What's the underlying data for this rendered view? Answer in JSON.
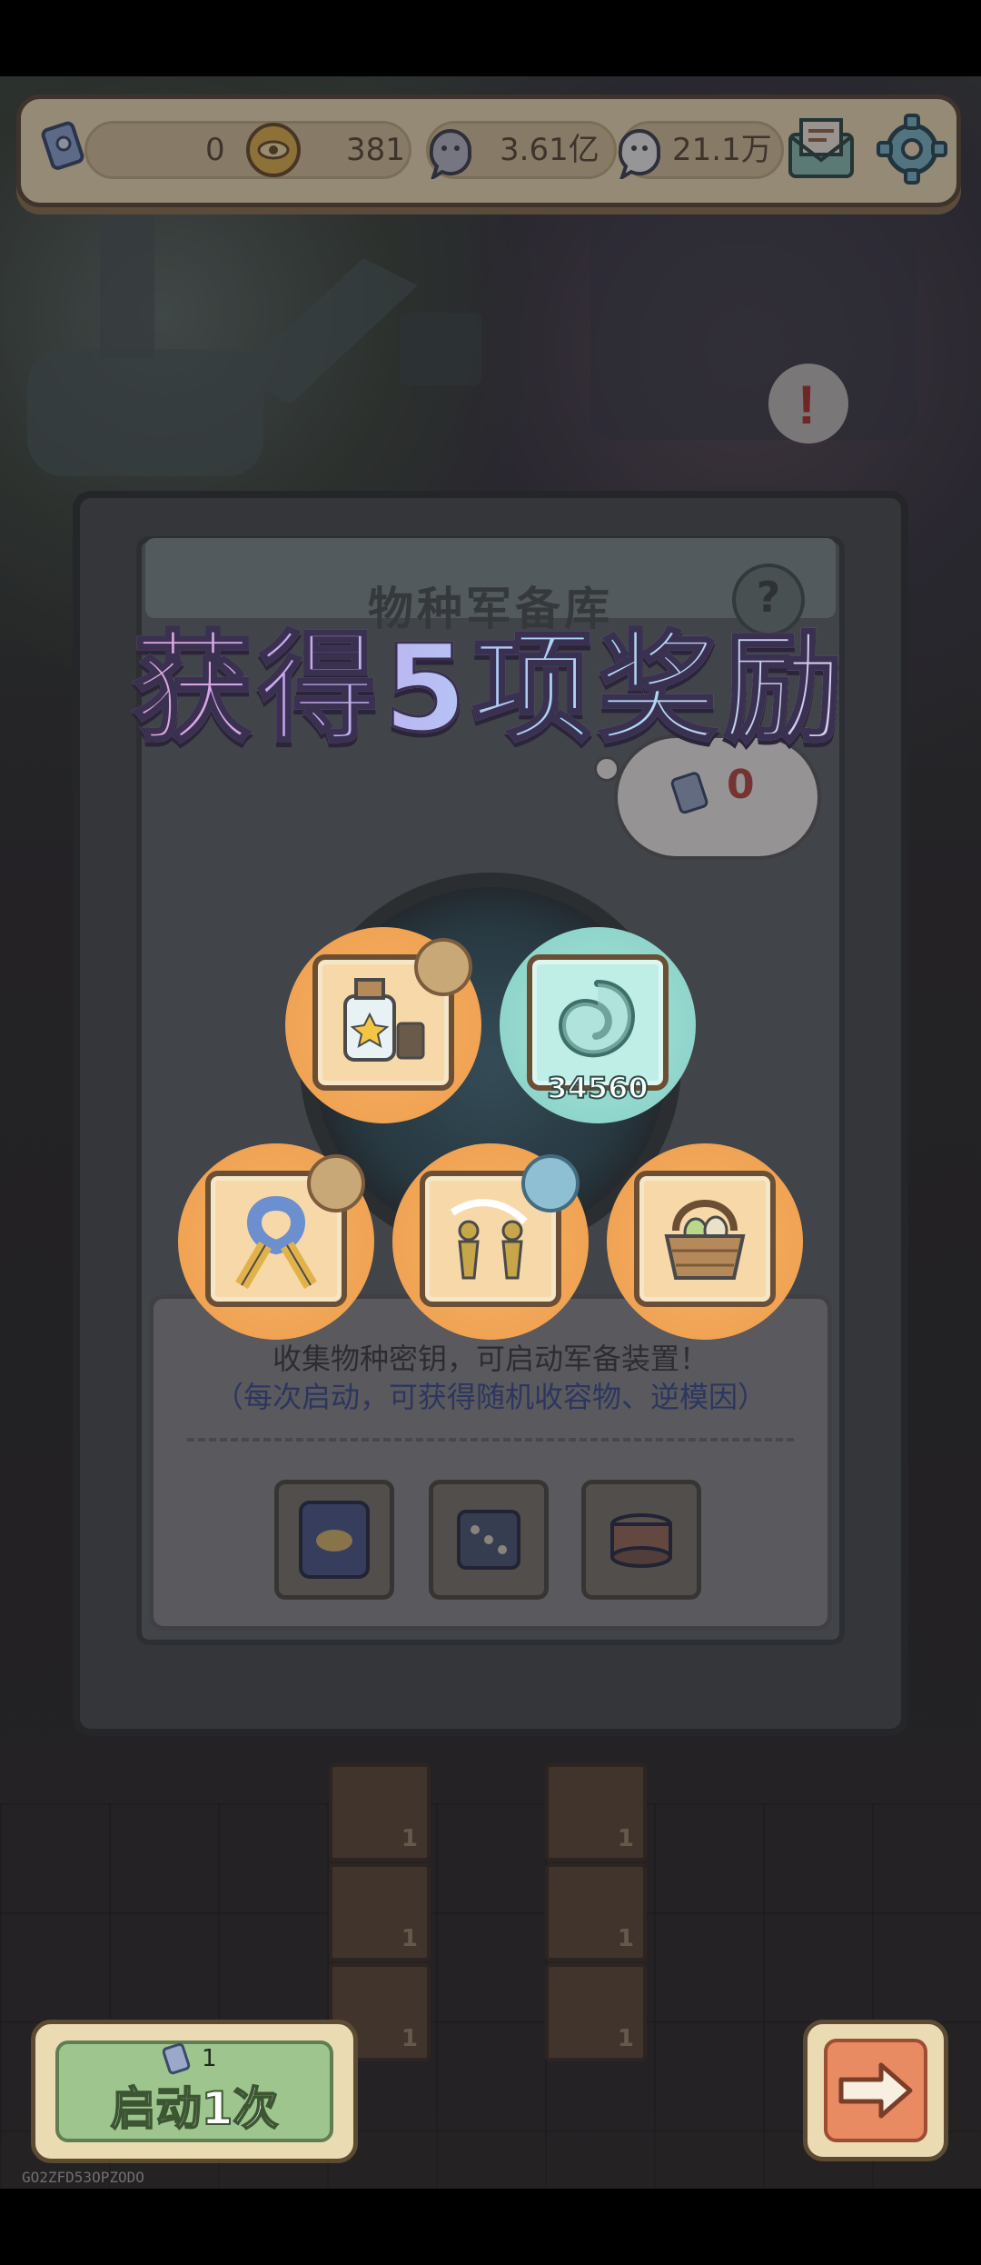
{
  "topbar": {
    "key_count": "0",
    "coins": "381",
    "ghost_currency": "3.61亿",
    "bubble_currency": "21.1万"
  },
  "panel": {
    "title": "物种军备库",
    "thought_value": "0",
    "info_line1": "收集物种密钥，可启动军备装置！",
    "info_line2": "（每次启动，可获得随机收容物、逆模因）"
  },
  "reward_popup": {
    "title": "获得5项奖励",
    "items": [
      {
        "name": "star-bottle",
        "count": ""
      },
      {
        "name": "swirl-token",
        "count": "34560"
      },
      {
        "name": "puzzle-ribbon",
        "count": ""
      },
      {
        "name": "twin-figures",
        "count": ""
      },
      {
        "name": "egg-basket",
        "count": ""
      }
    ]
  },
  "bottom": {
    "start_cost": "1",
    "start_label": "启动1次"
  },
  "floor_crates": [
    "1",
    "1",
    "1",
    "1",
    "1",
    "1"
  ],
  "watermark": "GO2ZFD53OPZODO",
  "colors": {
    "reward_orange": "#f0a353",
    "reward_teal": "#8fd5cb",
    "start_green": "#9fc58f",
    "next_orange": "#e88a62"
  }
}
